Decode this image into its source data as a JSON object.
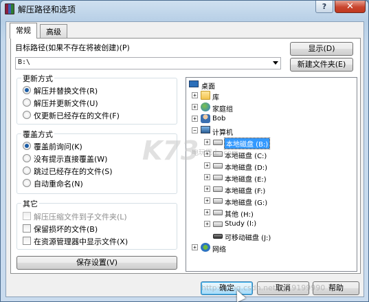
{
  "window": {
    "title": "解压路径和选项",
    "help_label": "?",
    "close_label": "✕"
  },
  "tabs": [
    {
      "label": "常规",
      "active": true
    },
    {
      "label": "高级",
      "active": false
    }
  ],
  "destination": {
    "label": "目标路径(如果不存在将被创建)(P)",
    "value": "B:\\",
    "show_button": "显示(D)",
    "new_folder_button": "新建文件夹(E)"
  },
  "update_mode": {
    "title": "更新方式",
    "options": [
      {
        "label": "解压并替换文件(R)",
        "selected": true
      },
      {
        "label": "解压并更新文件(U)",
        "selected": false
      },
      {
        "label": "仅更新已经存在的文件(F)",
        "selected": false
      }
    ]
  },
  "overwrite_mode": {
    "title": "覆盖方式",
    "options": [
      {
        "label": "覆盖前询问(K)",
        "selected": true
      },
      {
        "label": "没有提示直接覆盖(W)",
        "selected": false
      },
      {
        "label": "跳过已经存在的文件(S)",
        "selected": false
      },
      {
        "label": "自动重命名(N)",
        "selected": false
      }
    ]
  },
  "misc": {
    "title": "其它",
    "options": [
      {
        "label": "解压压缩文件到子文件夹(L)",
        "checked": false,
        "enabled": false
      },
      {
        "label": "保留损坏的文件(B)",
        "checked": false,
        "enabled": true
      },
      {
        "label": "在资源管理器中显示文件(X)",
        "checked": false,
        "enabled": true
      }
    ]
  },
  "save_button": "保存设置(V)",
  "tree": {
    "items": [
      {
        "label": "桌面",
        "icon": "desktop-icon",
        "expander": ""
      },
      {
        "label": "库",
        "icon": "library-icon",
        "expander": "+"
      },
      {
        "label": "家庭组",
        "icon": "homegroup-icon",
        "expander": "+"
      },
      {
        "label": "Bob",
        "icon": "user-icon",
        "expander": "+"
      },
      {
        "label": "计算机",
        "icon": "computer-icon",
        "expander": "−"
      },
      {
        "label": "本地磁盘 (B:)",
        "icon": "disk-icon",
        "expander": "+",
        "selected": true
      },
      {
        "label": "本地磁盘 (C:)",
        "icon": "disk-icon",
        "expander": "+"
      },
      {
        "label": "本地磁盘 (D:)",
        "icon": "disk-icon",
        "expander": "+"
      },
      {
        "label": "本地磁盘 (E:)",
        "icon": "disk-icon",
        "expander": "+"
      },
      {
        "label": "本地磁盘 (F:)",
        "icon": "disk-icon",
        "expander": "+"
      },
      {
        "label": "本地磁盘 (G:)",
        "icon": "disk-icon",
        "expander": "+"
      },
      {
        "label": "其他 (H:)",
        "icon": "disk-icon",
        "expander": "+"
      },
      {
        "label": "Study (I:)",
        "icon": "disk-icon",
        "expander": "+"
      },
      {
        "label": "可移动磁盘 (J:)",
        "icon": "removable-disk-icon",
        "expander": ""
      },
      {
        "label": "网络",
        "icon": "network-icon",
        "expander": "+"
      }
    ]
  },
  "footer": {
    "ok": "确定",
    "cancel": "取消",
    "help": "帮助"
  },
  "watermarks": {
    "logo": "K73",
    "site": "电玩巴士 .com",
    "url": "http://blog.csdn.net/zy19199990"
  },
  "colors": {
    "accent": "#3399ff",
    "title_gradient": "#b7cfe6",
    "close": "#c8452e"
  }
}
